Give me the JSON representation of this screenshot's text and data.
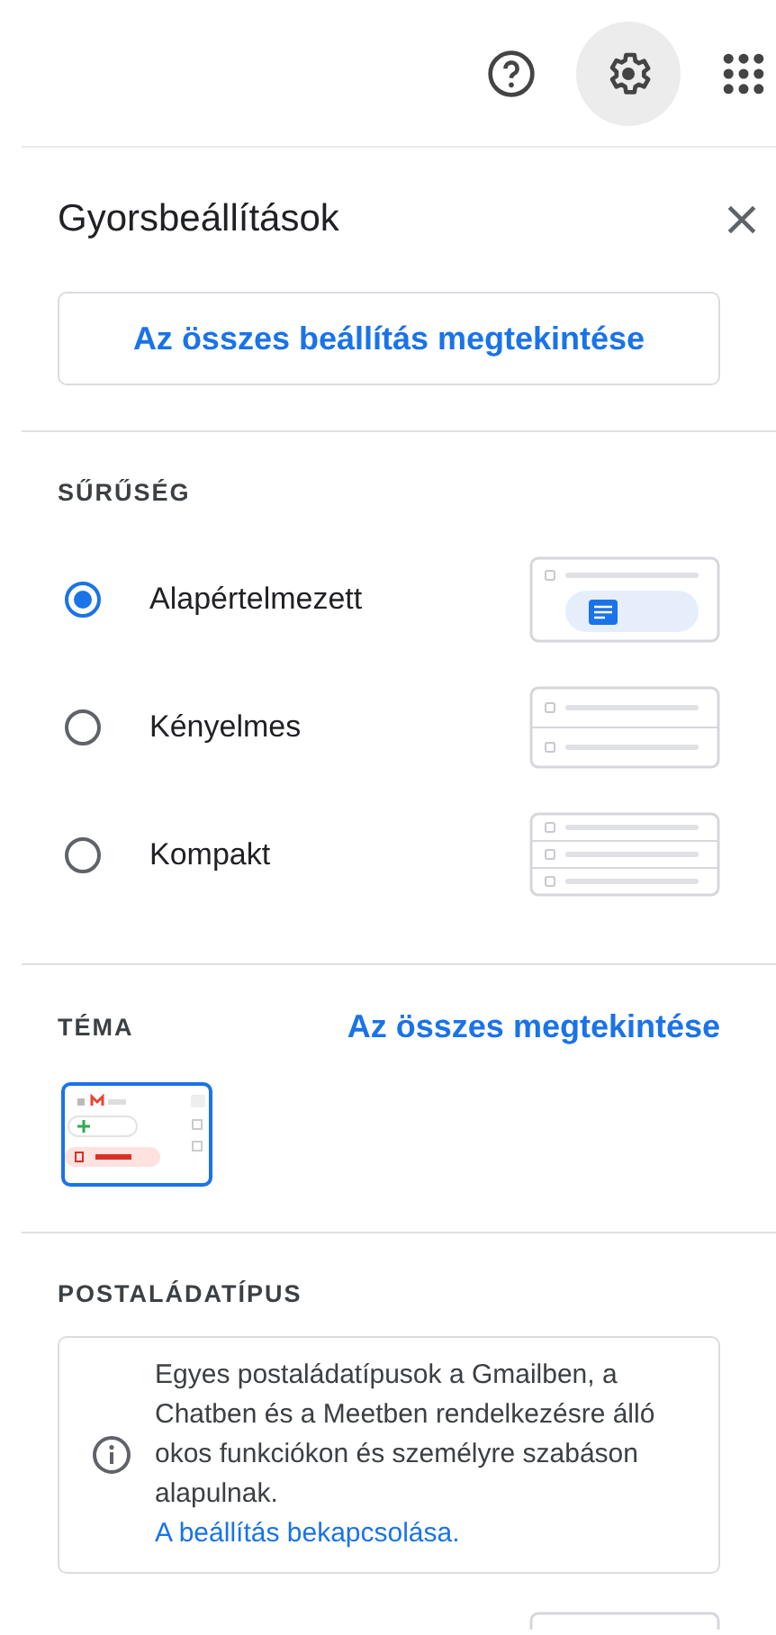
{
  "header": {
    "title": "Gyorsbeállítások",
    "all_settings_button": "Az összes beállítás megtekintése"
  },
  "density": {
    "heading": "SŰRŰSÉG",
    "options": [
      {
        "label": "Alapértelmezett",
        "selected": true,
        "kind": "default"
      },
      {
        "label": "Kényelmes",
        "selected": false,
        "kind": "comfortable"
      },
      {
        "label": "Kompakt",
        "selected": false,
        "kind": "compact"
      }
    ]
  },
  "theme": {
    "heading": "TÉMA",
    "link": "Az összes megtekintése",
    "themes": [
      {
        "kind": "picture",
        "selected": true
      }
    ]
  },
  "inbox_type": {
    "heading": "POSTALÁDATÍPUS",
    "notice": "Egyes postaládatípusok a Gmailben, a Chatben és a Meetben rendelkezésre álló okos funkciókon és személyre szabáson alapulnak.",
    "notice_link": "A beállítás bekapcsolása."
  }
}
